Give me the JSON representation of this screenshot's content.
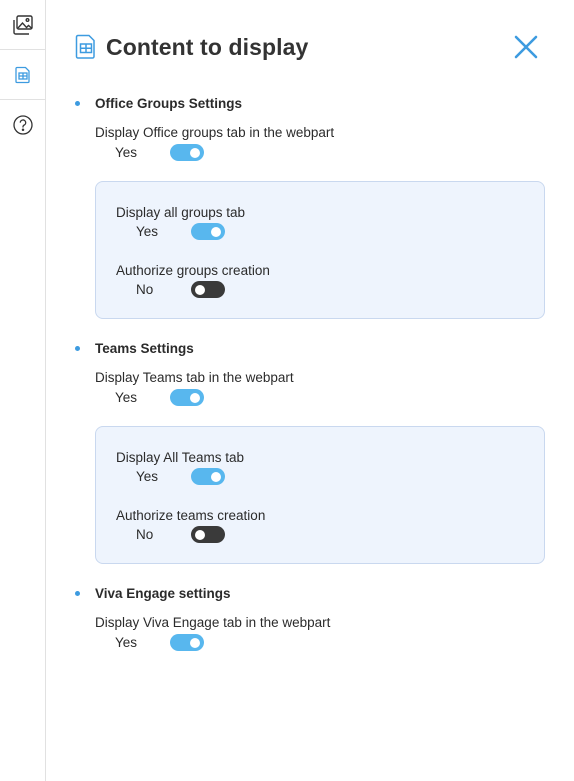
{
  "rail": {
    "items": [
      {
        "icon": "image-gallery-icon"
      },
      {
        "icon": "table-view-icon"
      },
      {
        "icon": "help-icon"
      }
    ]
  },
  "header": {
    "title": "Content to display",
    "icon": "table-view-icon",
    "close_icon": "close-icon"
  },
  "accent_color": "#3d9be0",
  "sections": {
    "office": {
      "title": "Office Groups Settings",
      "main_label": "Display Office groups tab in the webpart",
      "main_value": "Yes",
      "main_on": true,
      "sub": {
        "all_label": "Display all groups tab",
        "all_value": "Yes",
        "all_on": true,
        "create_label": "Authorize groups creation",
        "create_value": "No",
        "create_on": false
      }
    },
    "teams": {
      "title": "Teams Settings",
      "main_label": "Display Teams tab in the webpart",
      "main_value": "Yes",
      "main_on": true,
      "sub": {
        "all_label": "Display All Teams tab",
        "all_value": "Yes",
        "all_on": true,
        "create_label": "Authorize teams creation",
        "create_value": "No",
        "create_on": false
      }
    },
    "viva": {
      "title": "Viva Engage settings",
      "main_label": "Display Viva Engage tab in the webpart",
      "main_value": "Yes",
      "main_on": true
    }
  }
}
